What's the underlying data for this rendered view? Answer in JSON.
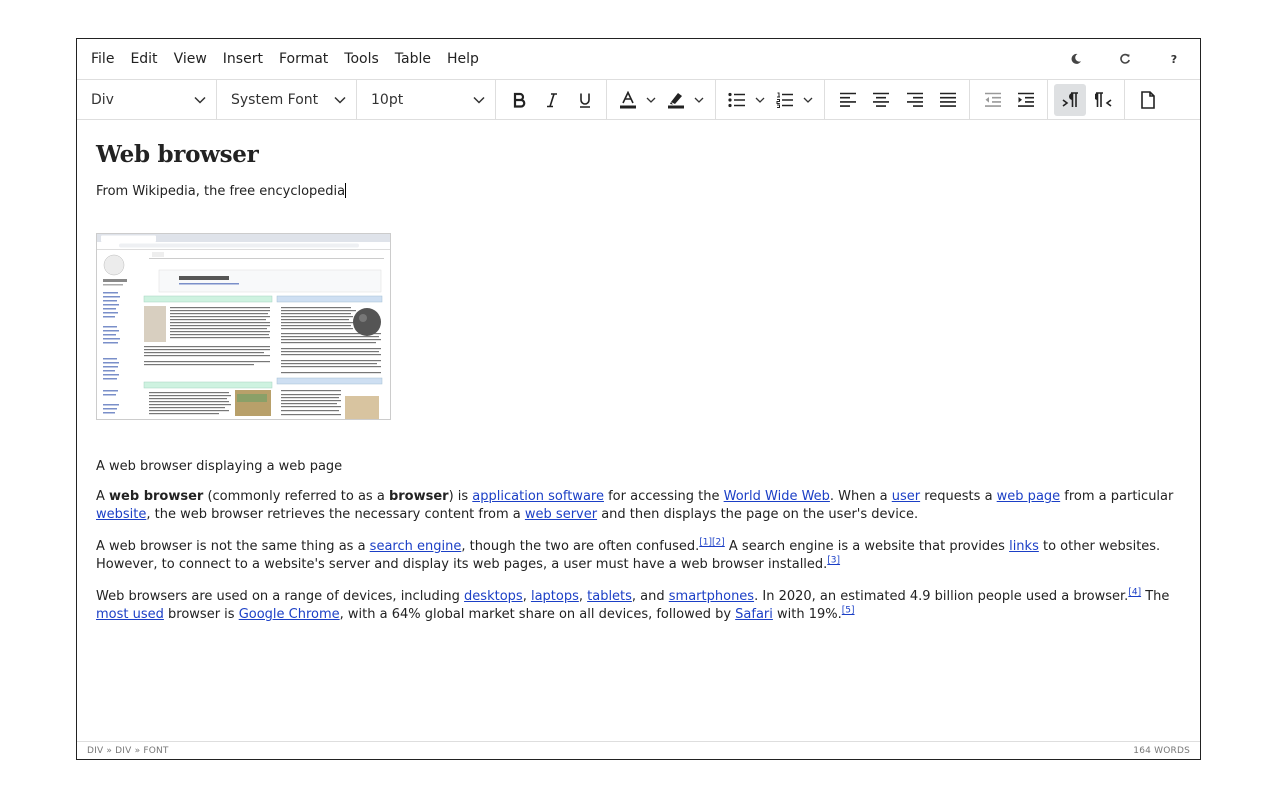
{
  "menu": {
    "items": [
      "File",
      "Edit",
      "View",
      "Insert",
      "Format",
      "Tools",
      "Table",
      "Help"
    ],
    "icons": [
      "moon-icon",
      "refresh-icon",
      "help-icon"
    ],
    "help_label": "?"
  },
  "toolbar": {
    "block_format": "Div",
    "font_family": "System Font",
    "font_size": "10pt"
  },
  "document": {
    "title": "Web browser",
    "subtitle": "From Wikipedia, the free encyclopedia",
    "caption": "A web browser displaying a web page",
    "p1": {
      "t1": "A ",
      "b1": "web browser",
      "t2": " (commonly referred to as a ",
      "b2": "browser",
      "t3": ") is ",
      "l1": "application software",
      "t4": " for accessing the ",
      "l2": "World Wide Web",
      "t5": ". When a ",
      "l3": "user",
      "t6": " requests a ",
      "l4": "web page",
      "t7": " from a particular ",
      "l5": "website",
      "t8": ", the web browser retrieves the necessary content from a ",
      "l6": "web server",
      "t9": " and then displays the page on the user's device."
    },
    "p2": {
      "t1": "A web browser is not the same thing as a ",
      "l1": "search engine",
      "t2": ", though the two are often confused.",
      "s1": "[1]",
      "s2": "[2]",
      "t3": " A search engine is a website that provides ",
      "l2": "links",
      "t4": " to other websites. However, to connect to a website's server and display its web pages, a user must have a web browser installed.",
      "s3": "[3]"
    },
    "p3": {
      "t1": "Web browsers are used on a range of devices, including ",
      "l1": "desktops",
      "t2": ", ",
      "l2": "laptops",
      "t3": ", ",
      "l3": "tablets",
      "t4": ", and ",
      "l4": "smartphones",
      "t5": ". In 2020, an estimated 4.9 billion people used a browser.",
      "s1": "[4]",
      "t6": " The ",
      "l5": "most used",
      "t7": " browser is ",
      "l6": "Google Chrome",
      "t8": ", with a 64% global market share on all devices, followed by ",
      "l7": "Safari",
      "t9": " with 19%.",
      "s2": "[5]"
    }
  },
  "statusbar": {
    "path": "DIV » DIV » FONT",
    "word_count": "164 WORDS"
  }
}
